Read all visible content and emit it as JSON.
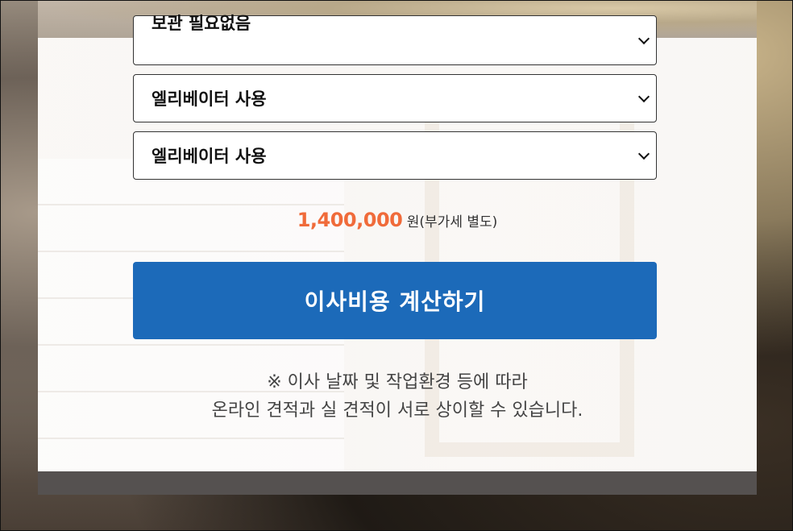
{
  "options": [
    {
      "label": "보관 필요없음"
    },
    {
      "label": "엘리베이터 사용"
    },
    {
      "label": "엘리베이터 사용"
    }
  ],
  "price": {
    "amount": "1,400,000",
    "suffix": "원(부가세 별도)"
  },
  "calculate_button": "이사비용 계산하기",
  "note": {
    "line1": "※ 이사 날짜 및 작업환경 등에 따라",
    "line2": "온라인 견적과 실 견적이 서로 상이할 수 있습니다."
  },
  "colors": {
    "accent": "#1c6ab9",
    "price": "#f06b3a"
  }
}
